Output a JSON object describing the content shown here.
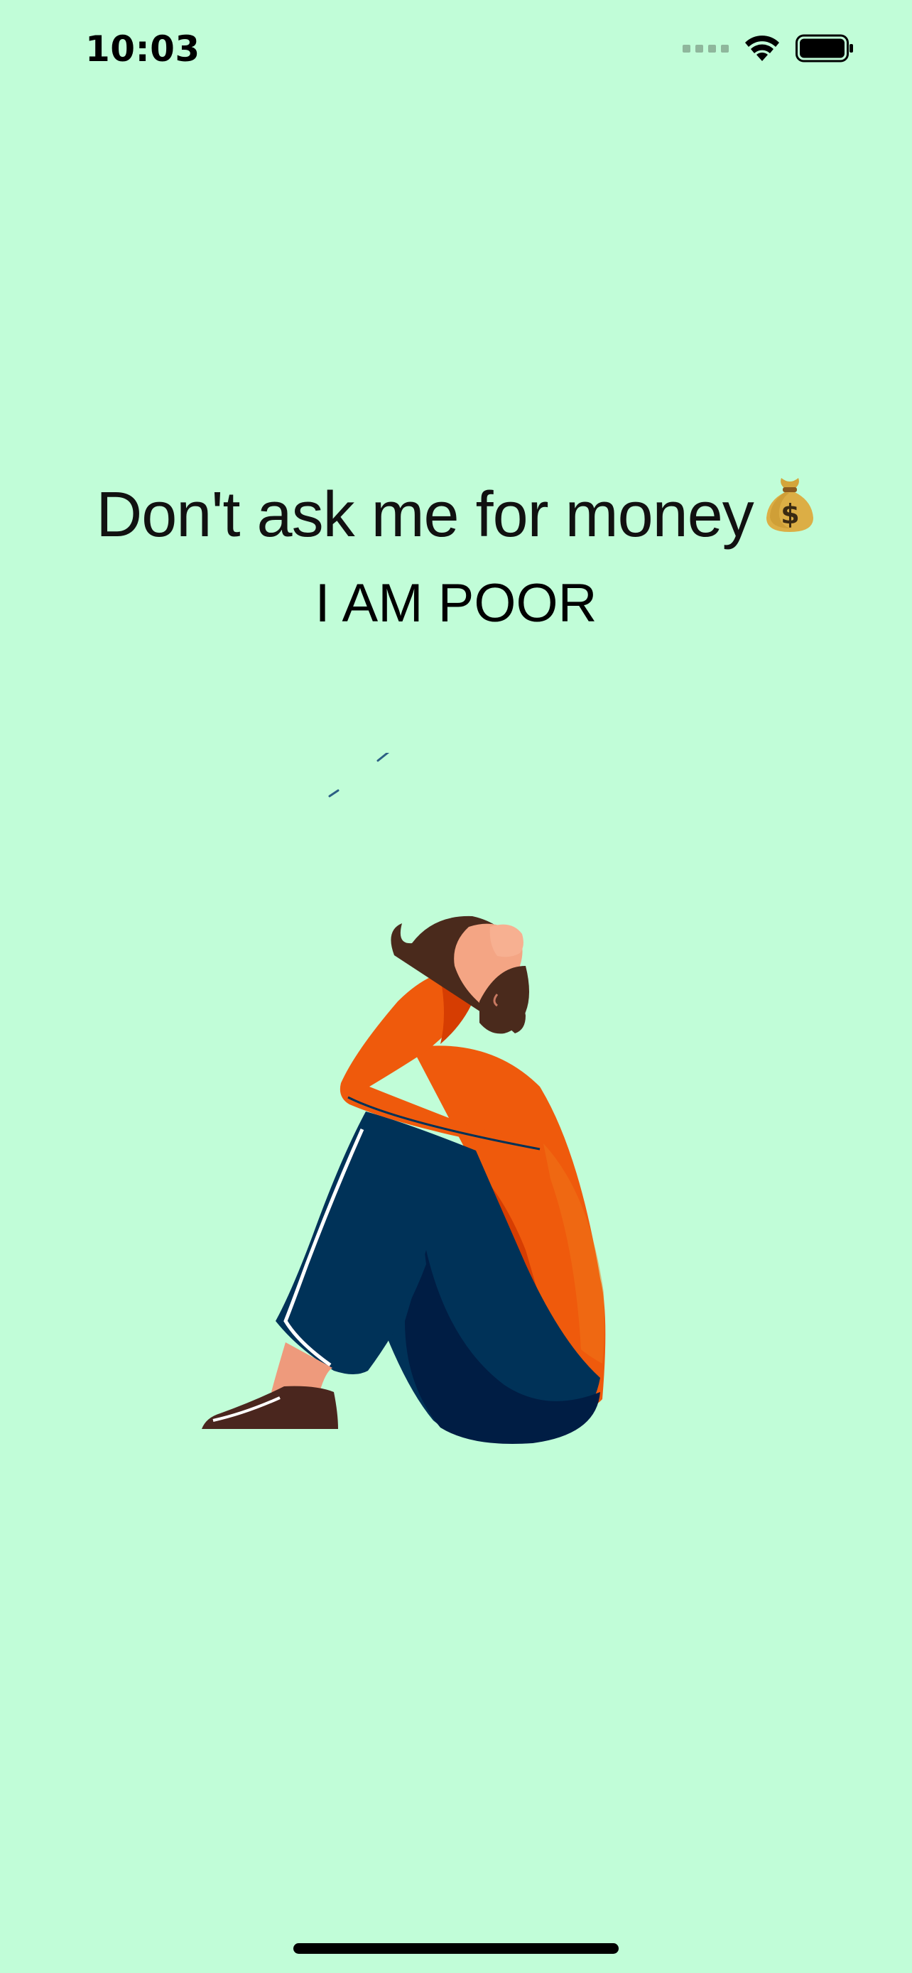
{
  "status_bar": {
    "time": "10:03",
    "icons": [
      "cellular-signal-icon",
      "wifi-icon",
      "battery-icon"
    ]
  },
  "content": {
    "headline": "Don't ask me for money",
    "headline_emoji": "money-bag-icon",
    "subhead": "I AM POOR",
    "illustration": "sad-person-sitting-illustration"
  },
  "colors": {
    "background": "#c1fdd8",
    "sweater": "#ef5a0c",
    "pants": "#003258",
    "hair": "#4a2a1c",
    "skin": "#f4a584"
  }
}
